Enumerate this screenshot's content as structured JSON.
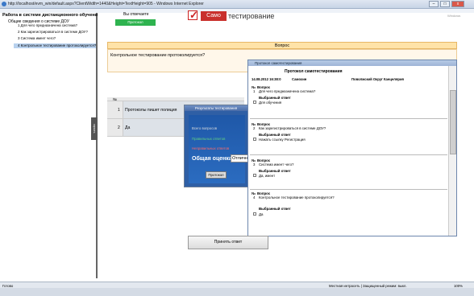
{
  "window": {
    "title": "http://localhost/evm_win/default.aspx?ClientWidth=1440&Height=TextHeight=905 - Windows Internet Explorer",
    "tab_label": "Windows"
  },
  "sidebar": {
    "title": "Работа в системе дистанционного обучения",
    "section": "Общие сведения о системе ДОУ",
    "items": [
      {
        "label": "1 Для чего предназначена система?"
      },
      {
        "label": "2 Как зарегистрироваться в системе ДОУ?"
      },
      {
        "label": "3 Система имеет чего?"
      },
      {
        "label": "4 Контрольное тестирование протоколируется?"
      }
    ],
    "handle_label": "скрыть"
  },
  "header": {
    "answered_label": "Вы отвечаете",
    "answered_badge": "Протокол",
    "logo_box": "Само",
    "logo_text": "тестирование",
    "corner_text": "Windows"
  },
  "question": {
    "header": "Вопрос",
    "text": "Контрольное тестирование протоколируется?"
  },
  "answers": {
    "col_no": "№",
    "rows": [
      {
        "no": "1",
        "text": "Протоколы пишет полиция"
      },
      {
        "no": "2",
        "text": "Да"
      }
    ]
  },
  "results": {
    "title": "Результаты тестирования",
    "total_label": "Всего вопросов",
    "correct_label": "Правильных ответов",
    "wrong_label": "Неправильных ответов",
    "score_label": "Общая оценка",
    "grade": "Отлично",
    "protocol_button": "Протокол"
  },
  "protocol": {
    "window_title": "Протокол самотестирования",
    "title": "Протокол самотестирования",
    "date": "14.08.2012 16:38:0",
    "name": "Самохин",
    "org": "Поволжский Округ Канцелярия",
    "q_label": "Вопрос",
    "no_label": "№",
    "chosen_label": "Выбранный ответ",
    "items": [
      {
        "no": "1",
        "question": "Для чего предназначена система?",
        "answer": "Для обучения"
      },
      {
        "no": "2",
        "question": "Как зарегистрироваться в системе ДОУ?",
        "answer": "Нажать ссылку Регистрация"
      },
      {
        "no": "3",
        "question": "Система имеет чего?",
        "answer": "Да, имеет"
      },
      {
        "no": "4",
        "question": "Контрольное тестирование протоколируется?",
        "answer": "Да"
      }
    ]
  },
  "accept_button": "Принять ответ",
  "status": {
    "left": "Готово",
    "zone": "Местная интрасеть | Защищенный режим: выкл.",
    "zoom": "100%"
  },
  "colors": {
    "accent_red": "#c9302c",
    "badge_green": "#2eb34f",
    "question_header": "#ffe3a8",
    "results_blue": "#2f5fa5"
  }
}
